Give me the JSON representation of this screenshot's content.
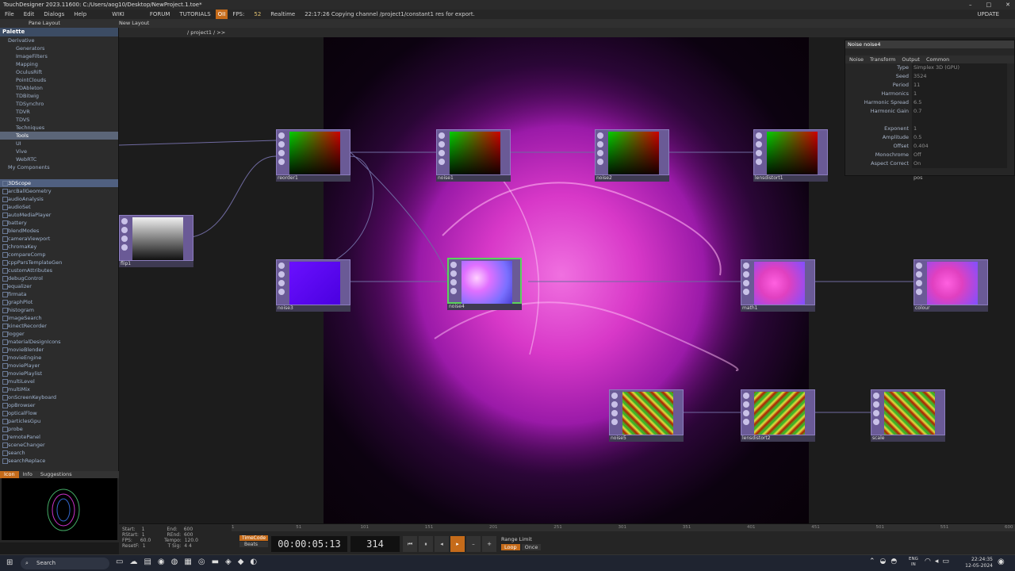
{
  "window": {
    "title": "TouchDesigner 2023.11600: C:/Users/aog10/Desktop/NewProject.1.toe*",
    "min": "–",
    "max": "□",
    "close": "✕"
  },
  "menubar": {
    "items": [
      "File",
      "Edit",
      "Dialogs",
      "Help"
    ],
    "wiki": "WIKI",
    "forum": "FORUM",
    "tutorials": "TUTORIALS",
    "oii": "OII",
    "fps_label": "FPS:",
    "fps_value": "52",
    "realtime": "Realtime",
    "status": "22:17:26 Copying channel /project1/constant1 res for export.",
    "update": "UPDATE"
  },
  "toolbar": {
    "pane_layout": "Pane Layout",
    "new_layout": "New Layout"
  },
  "path": {
    "text": "/ project1 / >>"
  },
  "palette": {
    "title": "Palette",
    "tree": [
      {
        "label": "Derivative",
        "level": 0
      },
      {
        "label": "Generators",
        "level": 1
      },
      {
        "label": "ImageFilters",
        "level": 1
      },
      {
        "label": "Mapping",
        "level": 1
      },
      {
        "label": "OculusRift",
        "level": 1
      },
      {
        "label": "PointClouds",
        "level": 1
      },
      {
        "label": "TDAbleton",
        "level": 1
      },
      {
        "label": "TDBitwig",
        "level": 1
      },
      {
        "label": "TDSynchro",
        "level": 1
      },
      {
        "label": "TDVR",
        "level": 1
      },
      {
        "label": "TDVS",
        "level": 1
      },
      {
        "label": "Techniques",
        "level": 1
      },
      {
        "label": "Tools",
        "level": 1
      },
      {
        "label": "UI",
        "level": 1
      },
      {
        "label": "Vive",
        "level": 1
      },
      {
        "label": "WebRTC",
        "level": 1
      },
      {
        "label": "My Components",
        "level": 0
      }
    ],
    "selected_tree": "Tools",
    "components": [
      "3DScope",
      "arcBallGeometry",
      "audioAnalysis",
      "audioSet",
      "autoMediaPlayer",
      "battery",
      "blendModes",
      "cameraViewport",
      "chromaKey",
      "compareComp",
      "cppParsTemplateGen",
      "customAttributes",
      "debugControl",
      "equalizer",
      "firmata",
      "graphPlot",
      "histogram",
      "imageSearch",
      "kinectRecorder",
      "logger",
      "materialDesignIcons",
      "movieBlender",
      "movieEngine",
      "moviePlayer",
      "moviePlaylist",
      "multiLevel",
      "multiMix",
      "onScreenKeyboard",
      "opBrowser",
      "opticalFlow",
      "particlesGpu",
      "probe",
      "remotePanel",
      "sceneChanger",
      "search",
      "searchReplace"
    ],
    "selected_component": "3DScope"
  },
  "icon_panel": {
    "tabs": [
      "Icon",
      "Info",
      "Suggestions"
    ]
  },
  "nodes": [
    {
      "name": "reorder1",
      "thumb": "grad-green"
    },
    {
      "name": "noise1",
      "thumb": "grad-green"
    },
    {
      "name": "noise2",
      "thumb": "grad-green"
    },
    {
      "name": "lensdistort1",
      "thumb": "grad-green"
    },
    {
      "name": "flip1",
      "thumb": "grad-gray"
    },
    {
      "name": "noise3",
      "thumb": "solid-violet"
    },
    {
      "name": "noise4",
      "thumb": "noise-pink"
    },
    {
      "name": "math1",
      "thumb": "noise-pink"
    },
    {
      "name": "colour",
      "thumb": "noise-pink"
    },
    {
      "name": "noise5",
      "thumb": "tex-green"
    },
    {
      "name": "lensdistort2",
      "thumb": "tex-green"
    },
    {
      "name": "scale",
      "thumb": "tex-green"
    }
  ],
  "params": {
    "op_type": "Noise",
    "op_name": "noise4",
    "tabs": [
      "Noise",
      "Transform",
      "Output",
      "Common"
    ],
    "rows": [
      {
        "label": "Type",
        "value": "Simplex 3D (GPU)"
      },
      {
        "label": "Seed",
        "value": "3524"
      },
      {
        "label": "Period",
        "value": "11"
      },
      {
        "label": "Harmonics",
        "value": "1"
      },
      {
        "label": "Harmonic Spread",
        "value": "6.5"
      },
      {
        "label": "Harmonic Gain",
        "value": "0.7"
      },
      {
        "label": "",
        "value": ""
      },
      {
        "label": "Exponent",
        "value": "1"
      },
      {
        "label": "Amplitude",
        "value": "0.5"
      },
      {
        "label": "Offset",
        "value": "0.404"
      },
      {
        "label": "Monochrome",
        "value": "Off"
      },
      {
        "label": "Aspect Correct",
        "value": "On"
      }
    ],
    "pos_label": "pos"
  },
  "timeline": {
    "start_label": "Start:",
    "start": "1",
    "end_label": "End:",
    "end": "600",
    "rstart_label": "RStart:",
    "rstart": "1",
    "rend_label": "REnd:",
    "rend": "600",
    "fps_label": "FPS:",
    "fps": "60.0",
    "tempo_label": "Tempo:",
    "tempo": "120.0",
    "resetf_label": "ResetF:",
    "resetf": "1",
    "tsig_label": "T Sig:",
    "tsig": "4 4",
    "timecode": "TimeCode",
    "beats": "Beats",
    "time": "00:00:05:13",
    "frame": "314",
    "range_limit": "Range Limit",
    "loop": "Loop",
    "once": "Once",
    "ticks": [
      "1",
      "51",
      "101",
      "151",
      "201",
      "251",
      "301",
      "351",
      "401",
      "451",
      "501",
      "551",
      "600"
    ]
  },
  "taskbar": {
    "search": "Search",
    "lang": "ENG",
    "region": "IN",
    "time": "22:24:35",
    "date": "12-05-2024"
  }
}
